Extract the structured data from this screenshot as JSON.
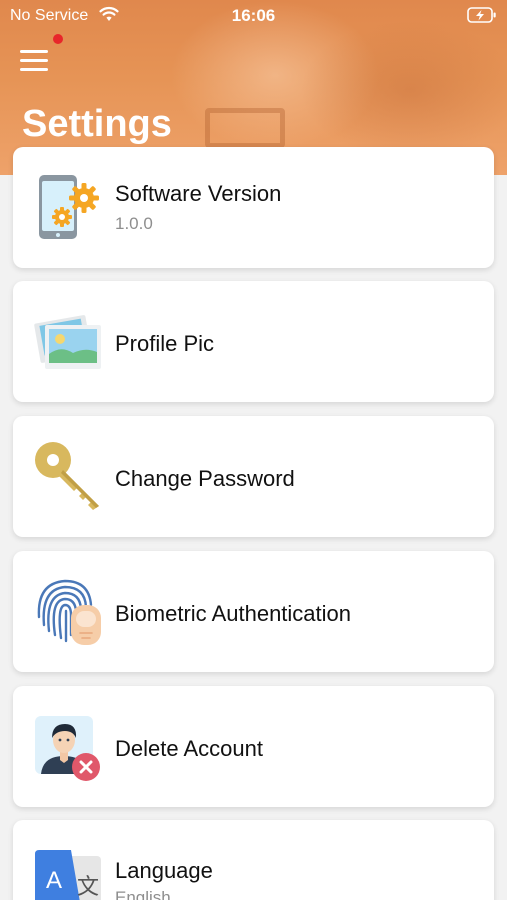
{
  "status_bar": {
    "carrier": "No Service",
    "time": "16:06"
  },
  "header": {
    "title": "Settings",
    "menu_icon": "hamburger-menu-icon",
    "notification_color": "#e8262a",
    "background_color": "#e69456"
  },
  "settings": [
    {
      "title": "Software Version",
      "subtitle": "1.0.0",
      "icon": "phone-gears-icon"
    },
    {
      "title": "Profile Pic",
      "subtitle": "",
      "icon": "photos-icon"
    },
    {
      "title": "Change Password",
      "subtitle": "",
      "icon": "key-icon"
    },
    {
      "title": "Biometric Authentication",
      "subtitle": "",
      "icon": "fingerprint-icon"
    },
    {
      "title": "Delete Account",
      "subtitle": "",
      "icon": "delete-user-icon"
    },
    {
      "title": "Language",
      "subtitle": "English",
      "icon": "translate-icon"
    }
  ]
}
